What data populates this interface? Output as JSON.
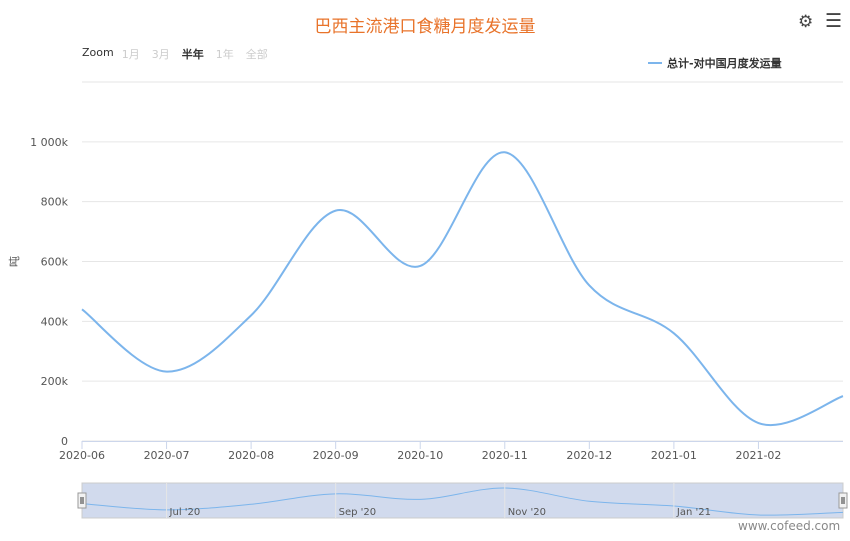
{
  "header": {
    "title": "巴西主流港口食糖月度发运量",
    "settings_icon": "gear-icon",
    "menu_icon": "hamburger-menu-icon"
  },
  "zoom": {
    "label": "Zoom",
    "buttons": [
      {
        "label": "1月",
        "active": false
      },
      {
        "label": "3月",
        "active": false
      },
      {
        "label": "半年",
        "active": true
      },
      {
        "label": "1年",
        "active": false
      },
      {
        "label": "全部",
        "active": false
      }
    ]
  },
  "legend": {
    "items": [
      {
        "label": "总计-对中国月度发运量",
        "color": "#7cb5ec"
      }
    ]
  },
  "chart_data": {
    "type": "line",
    "ylabel": "吨",
    "ylim": [
      0,
      1000000
    ],
    "y_ticks": [
      0,
      200000,
      400000,
      600000,
      800000,
      1000000
    ],
    "y_tick_labels": [
      "0",
      "200k",
      "400k",
      "600k",
      "800k",
      "1 000k"
    ],
    "x_tick_labels": [
      "2020-06",
      "2020-07",
      "2020-08",
      "2020-09",
      "2020-10",
      "2020-11",
      "2020-12",
      "2021-01",
      "2021-02"
    ],
    "grid": true,
    "series": [
      {
        "name": "总计-对中国月度发运量",
        "color": "#7cb5ec",
        "x": [
          "2020-06",
          "2020-07",
          "2020-08",
          "2020-09",
          "2020-10",
          "2020-11",
          "2020-12",
          "2021-01",
          "2021-02",
          "2021-03"
        ],
        "values": [
          440000,
          232000,
          420000,
          770000,
          585000,
          965000,
          520000,
          360000,
          60000,
          150000
        ]
      }
    ]
  },
  "navigator": {
    "labels": [
      "Jul '20",
      "Sep '20",
      "Nov '20",
      "Jan '21"
    ]
  },
  "watermark": "www.cofeed.com"
}
